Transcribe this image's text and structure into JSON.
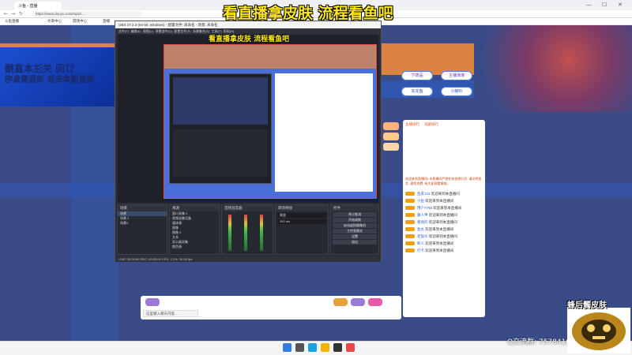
{
  "caption": "看直播拿皮肤 流程看鱼吧",
  "nested_caption": "看直播拿皮肤 流程看鱼吧",
  "browser": {
    "tab_title": "斗鱼 - 直播",
    "url": "https://www.douyu.com/topic/..."
  },
  "bookmarks": [
    "斗鱼直播",
    "文章中心",
    "游戏中心",
    "直播"
  ],
  "obs": {
    "title": "OBS 27.2.3 (64-bit, windows) - 配置文件: 未命名 - 场景: 未命名",
    "menu": [
      "文件(F)",
      "编辑(E)",
      "视图(V)",
      "停靠部件(D)",
      "配置文件(P)",
      "场景集合(S)",
      "工具(T)",
      "帮助(H)"
    ],
    "docks": {
      "scenes": "场景",
      "sources": "来源",
      "mixer": "音频混音器",
      "transitions": "转场特效",
      "controls": "控件"
    },
    "scenes": [
      "场景",
      "场景 2",
      "场景3"
    ],
    "sources": [
      "窗口采集 2",
      "视频采集设备",
      "媒体源",
      "图像",
      "图像 2",
      "文本",
      "显示器采集",
      "颜色源"
    ],
    "transition": "渐变",
    "duration": "300 ms",
    "controls": [
      "停止推流",
      "开始录制",
      "启动虚拟摄像机",
      "工作室模式",
      "设置",
      "退出"
    ],
    "status": "LIVE: 00:00:00   REC: 00:00:00   CPU: 2.1%, 30.00 fps"
  },
  "page": {
    "mirror_text_1": "订阅 关注本直播",
    "mirror_text_2": "看直播拿皮肤 流程看鱼吧",
    "buttons": [
      "下饰品",
      "主播演演",
      "充充鱼",
      "小喇叭"
    ]
  },
  "chat": {
    "tabs": [
      "主播排行",
      "贡献排行"
    ],
    "notice": "欢迎来到直播间! 本直播间严禁任何违规行为, 请文明发言, 理性消费, 祝大家观看愉快。",
    "rows": [
      {
        "name": "鱼友123",
        "text": "欢迎来到本直播间"
      },
      {
        "name": "小鱼",
        "text": "欢迎来到本直播间"
      },
      {
        "name": "用户7788",
        "text": "欢迎来到本直播间"
      },
      {
        "name": "路人甲",
        "text": "欢迎来到本直播间"
      },
      {
        "name": "看戏的",
        "text": "欢迎来到本直播间"
      },
      {
        "name": "鱼丸",
        "text": "欢迎来到本直播间"
      },
      {
        "name": "老观众",
        "text": "欢迎来到本直播间"
      },
      {
        "name": "新人",
        "text": "欢迎来到本直播间"
      },
      {
        "name": "打卡",
        "text": "欢迎来到本直播间"
      }
    ]
  },
  "input": {
    "placeholder": "这里输入聊天内容..."
  },
  "qq_group": "Q交流群: 757841094",
  "cam_label": "蜂后髑皮肤",
  "colors": {
    "caption": "#ffe81a",
    "accent_blue": "#2451c7",
    "orange": "#f08a3a"
  }
}
